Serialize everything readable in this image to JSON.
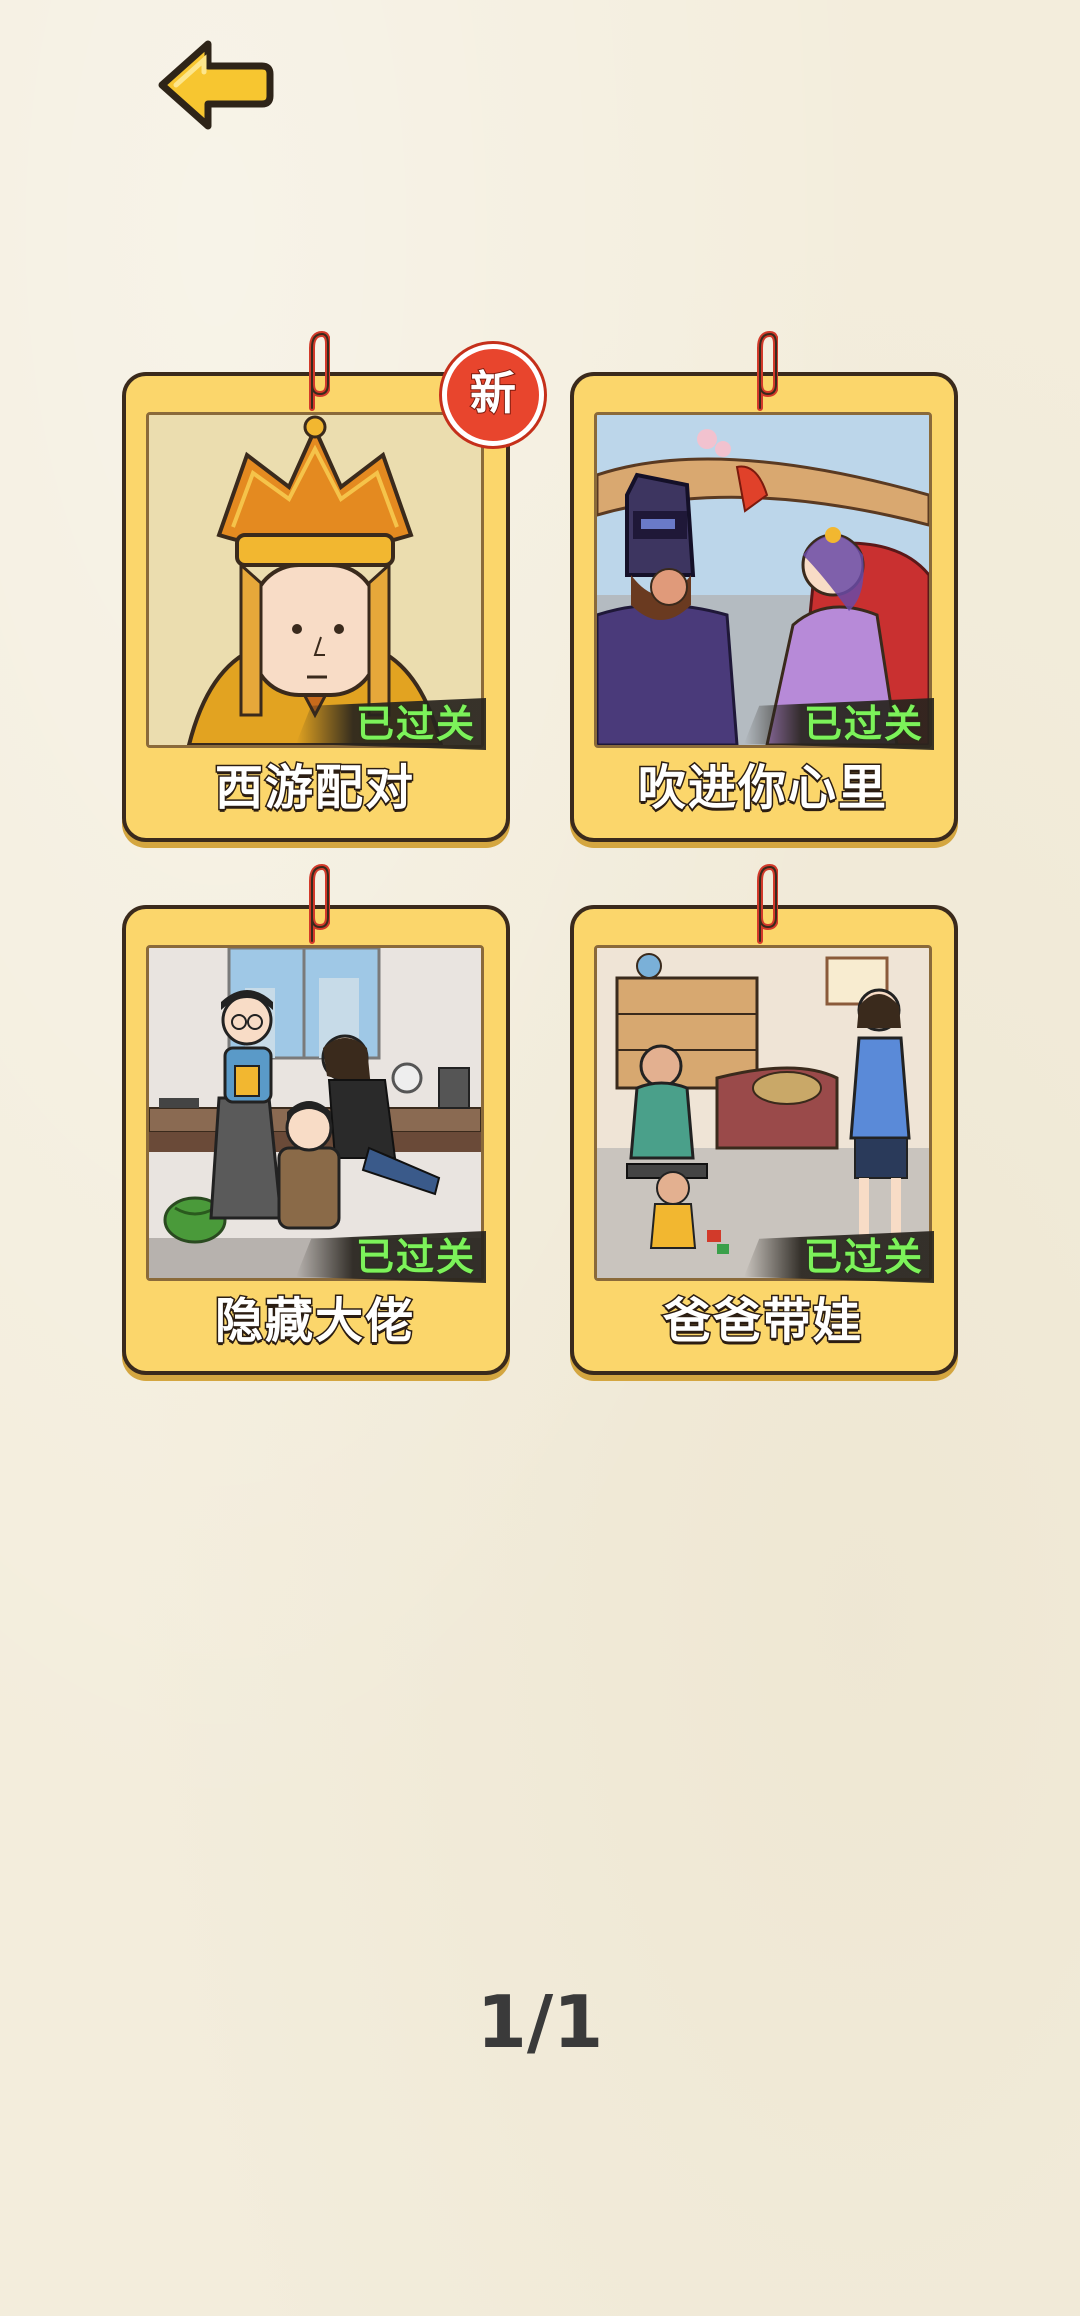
{
  "back": {
    "icon": "arrow-left-icon"
  },
  "levels": [
    {
      "title": "西游配对",
      "status": "已过关",
      "badge": "新",
      "scene": "monk-portrait"
    },
    {
      "title": "吹进你心里",
      "status": "已过关",
      "badge": null,
      "scene": "warrior-and-lady"
    },
    {
      "title": "隐藏大佬",
      "status": "已过关",
      "badge": null,
      "scene": "office"
    },
    {
      "title": "爸爸带娃",
      "status": "已过关",
      "badge": null,
      "scene": "living-room"
    }
  ],
  "pagination": {
    "label": "1/1"
  },
  "colors": {
    "background": "#f3eddc",
    "card": "#fbd66b",
    "cleared_text": "#7cf25a",
    "badge": "#e8452d"
  }
}
